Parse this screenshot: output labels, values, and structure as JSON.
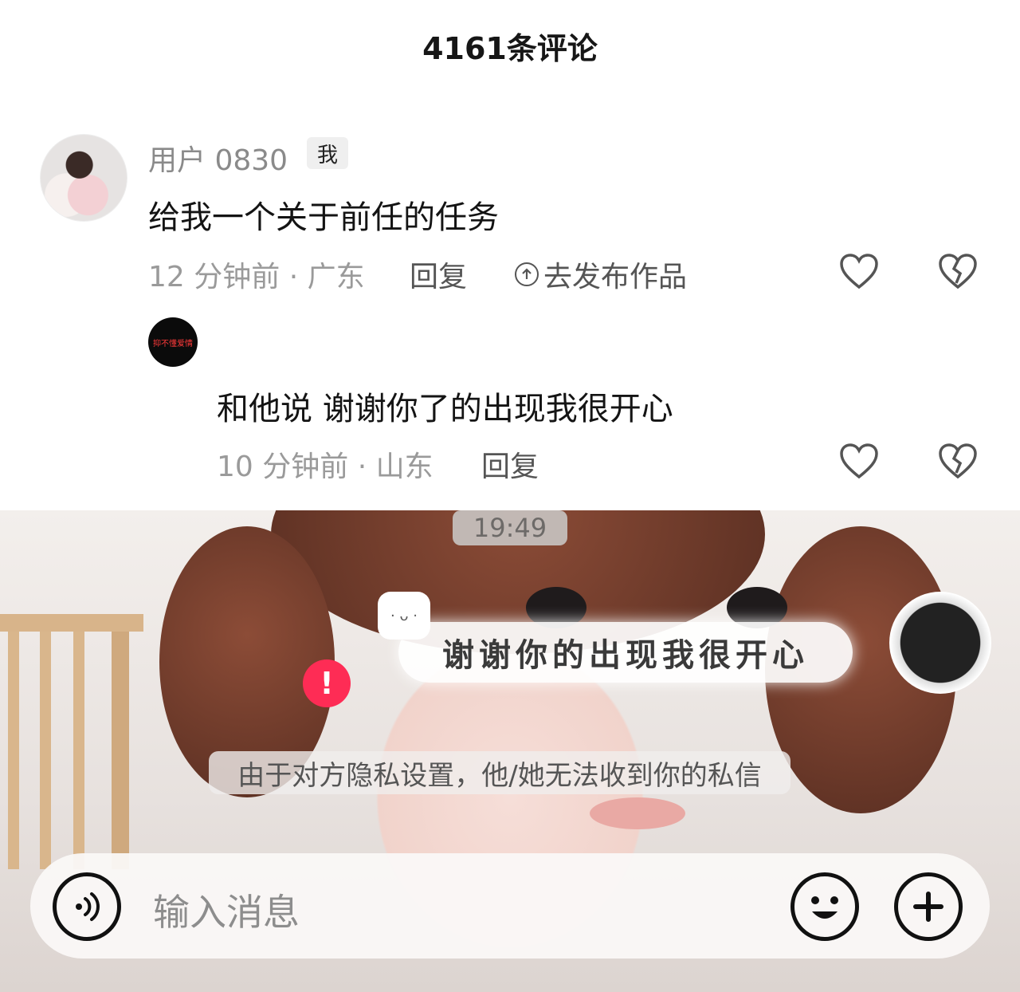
{
  "header": {
    "title": "4161条评论"
  },
  "comment1": {
    "username": "用户 0830",
    "tag": "我",
    "text": "给我一个关于前任的任务",
    "time_location": "12 分钟前 · 广东",
    "reply_label": "回复",
    "publish_label": "去发布作品"
  },
  "comment2": {
    "avatar_text": "抑不懂爱情",
    "text": "和他说 谢谢你了的出现我很开心",
    "time_location": "10 分钟前 · 山东",
    "reply_label": "回复"
  },
  "chat": {
    "time": "19:49",
    "message": "谢谢你的出现我很开心",
    "alert_symbol": "!",
    "notice": "由于对方隐私设置，他/她无法收到你的私信",
    "input_placeholder": "输入消息"
  },
  "icons": [
    "heart-icon",
    "broken-heart-icon",
    "voice-icon",
    "emoji-icon",
    "plus-icon",
    "upload-circle-icon"
  ],
  "colors": {
    "alert_red": "#fe2c55",
    "text_dark": "#141414",
    "meta_gray": "#9a9a9a"
  }
}
